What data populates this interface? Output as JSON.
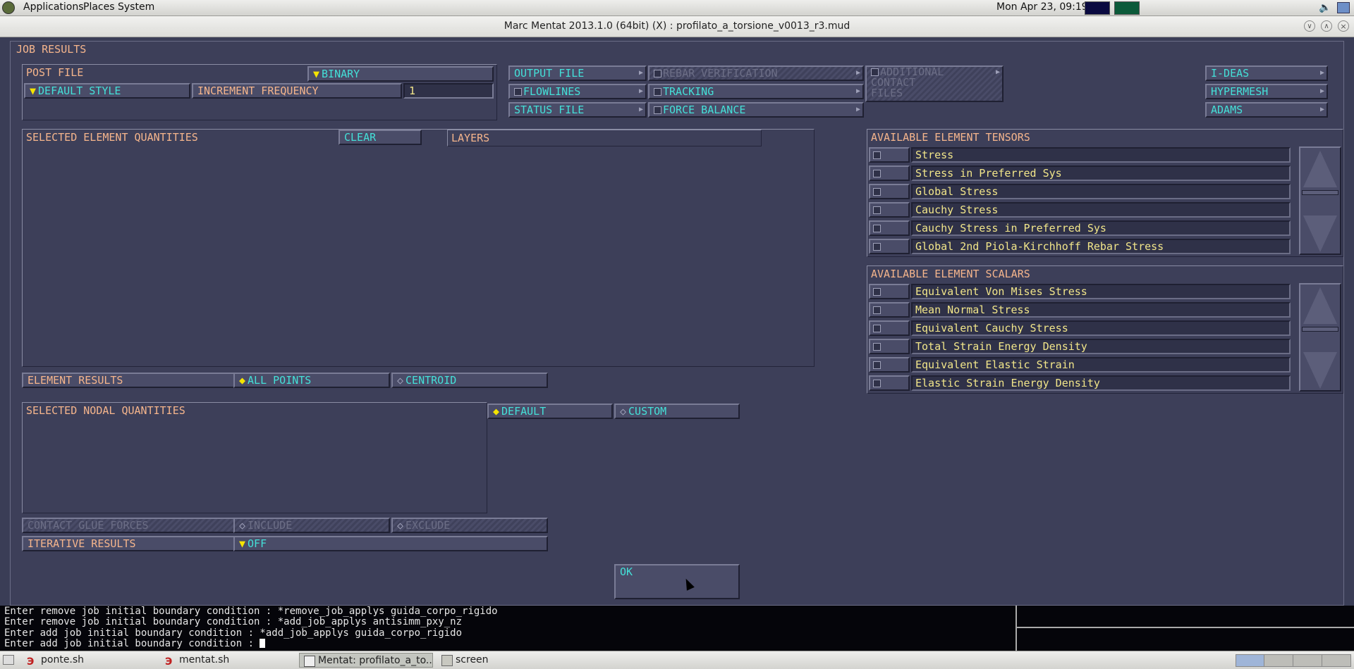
{
  "top_panel": {
    "menus": [
      "Applications",
      "Places",
      "System"
    ],
    "clock": "Mon Apr 23, 09:19"
  },
  "window": {
    "title": "Marc Mentat 2013.1.0 (64bit) (X) : profilato_a_torsione_v0013_r3.mud"
  },
  "dialog": {
    "title": "JOB RESULTS",
    "post_file": {
      "label": "POST FILE",
      "format": "BINARY"
    },
    "default_style": "DEFAULT STYLE",
    "increment_frequency": {
      "label": "INCREMENT FREQUENCY",
      "value": "1"
    },
    "output_buttons": {
      "output_file": "OUTPUT FILE",
      "flowlines": "FLOWLINES",
      "status_file": "STATUS FILE",
      "rebar_verification": "REBAR VERIFICATION",
      "tracking": "TRACKING",
      "force_balance": "FORCE BALANCE",
      "additional_contact_files": [
        "ADDITIONAL",
        "CONTACT",
        "FILES"
      ]
    },
    "export_buttons": [
      "I-DEAS",
      "HYPERMESH",
      "ADAMS"
    ],
    "selected_element_quantities": {
      "label": "SELECTED ELEMENT QUANTITIES",
      "clear": "CLEAR",
      "layers": "LAYERS"
    },
    "available_element_tensors": {
      "label": "AVAILABLE ELEMENT TENSORS",
      "items": [
        "Stress",
        "Stress in Preferred Sys",
        "Global Stress",
        "Cauchy Stress",
        "Cauchy Stress in Preferred Sys",
        "Global 2nd Piola-Kirchhoff Rebar Stress"
      ]
    },
    "available_element_scalars": {
      "label": "AVAILABLE ELEMENT SCALARS",
      "items": [
        "Equivalent Von Mises Stress",
        "Mean Normal Stress",
        "Equivalent Cauchy Stress",
        "Total Strain Energy Density",
        "Equivalent Elastic Strain",
        "Elastic Strain Energy Density"
      ]
    },
    "element_results": {
      "label": "ELEMENT RESULTS",
      "all_points": "ALL POINTS",
      "centroid": "CENTROID",
      "selected": "ALL POINTS"
    },
    "selected_nodal_quantities": {
      "label": "SELECTED NODAL QUANTITIES",
      "default": "DEFAULT",
      "custom": "CUSTOM",
      "selected": "DEFAULT"
    },
    "contact_glue_forces": {
      "label": "CONTACT GLUE FORCES",
      "include": "INCLUDE",
      "exclude": "EXCLUDE"
    },
    "iterative_results": {
      "label": "ITERATIVE RESULTS",
      "value": "OFF"
    },
    "ok": "OK"
  },
  "console": {
    "lines": [
      "Enter remove job initial boundary condition : *remove_job_applys guida_corpo_rigido",
      "Enter remove job initial boundary condition : *add_job_applys antisimm_pxy_nz",
      "Enter add job initial boundary condition : *add_job_applys guida_corpo_rigido",
      "Enter add job initial boundary condition : "
    ]
  },
  "taskbar": {
    "tasks": [
      "ponte.sh",
      "mentat.sh",
      "Mentat: profilato_a_to...",
      "screen"
    ]
  },
  "colors": {
    "dialog_bg": "#3d3f59",
    "label": "#f5b58c",
    "button_text": "#44e0d8",
    "value_text": "#f2e68a",
    "selected_diamond": "#f5e400"
  }
}
